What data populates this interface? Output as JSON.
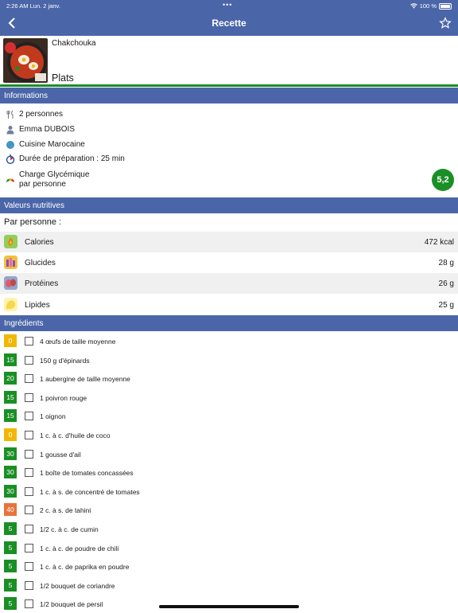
{
  "status_bar": {
    "time_date": "2:26 AM   Lun. 2 janv.",
    "dots": "•••",
    "battery": "100 %"
  },
  "nav": {
    "title": "Recette",
    "back_icon": "chevron-left-icon",
    "favorite_icon": "star-outline-icon"
  },
  "recipe": {
    "name": "Chakchouka",
    "category": "Plats"
  },
  "colors": {
    "primary": "#4b66a8",
    "green": "#1a8f25",
    "yellow": "#f2b705",
    "orange": "#e8733a"
  },
  "sections": {
    "info": "Informations",
    "nutrition": "Valeurs nutritives",
    "ingredients": "Ingrédients"
  },
  "info": {
    "servings": "2 personnes",
    "author": "Emma DUBOIS",
    "cuisine": "Cuisine Marocaine",
    "prep": "Durée de préparation : 25 min",
    "glycemic_line1": "Charge Glycémique",
    "glycemic_line2": "par personne",
    "glycemic_value": "5,2"
  },
  "nutrition": {
    "per_person": "Par personne :",
    "rows": [
      {
        "label": "Calories",
        "value": "472 kcal"
      },
      {
        "label": "Glucides",
        "value": "28 g"
      },
      {
        "label": "Protéines",
        "value": "26 g"
      },
      {
        "label": "Lipides",
        "value": "25 g"
      }
    ]
  },
  "ingredients": [
    {
      "ig": "0",
      "level": "yellow",
      "text": "4 œufs de taille moyenne"
    },
    {
      "ig": "15",
      "level": "green",
      "text": "150 g d'épinards"
    },
    {
      "ig": "20",
      "level": "green",
      "text": "1 aubergine de taille moyenne"
    },
    {
      "ig": "15",
      "level": "green",
      "text": "1 poivron rouge"
    },
    {
      "ig": "15",
      "level": "green",
      "text": "1 oignon"
    },
    {
      "ig": "0",
      "level": "yellow",
      "text": "1 c. à c. d'huile de coco"
    },
    {
      "ig": "30",
      "level": "green",
      "text": "1 gousse d'ail"
    },
    {
      "ig": "30",
      "level": "green",
      "text": "1 boîte de tomates concassées"
    },
    {
      "ig": "30",
      "level": "green",
      "text": "1 c. à s. de concentré de tomates"
    },
    {
      "ig": "40",
      "level": "orange",
      "text": "2 c. à s. de tahini"
    },
    {
      "ig": "5",
      "level": "green",
      "text": "1/2 c. à c. de cumin"
    },
    {
      "ig": "5",
      "level": "green",
      "text": "1 c. à c. de poudre de chili"
    },
    {
      "ig": "5",
      "level": "green",
      "text": "1 c. à c. de paprika en poudre"
    },
    {
      "ig": "5",
      "level": "green",
      "text": "1/2 bouquet de coriandre"
    },
    {
      "ig": "5",
      "level": "green",
      "text": "1/2 bouquet de persil"
    }
  ]
}
